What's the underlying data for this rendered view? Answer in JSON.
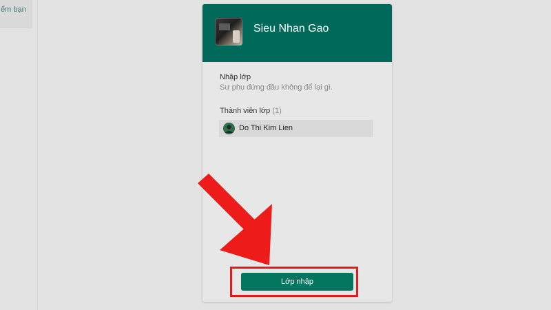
{
  "sidebar": {
    "link_text": "ểm bạn"
  },
  "card": {
    "class_name": "Sieu Nhan Gao",
    "join_section_title": "Nhập lớp",
    "join_section_note": "Sư phụ đứng đầu không để lại gì.",
    "members_title": "Thành viên lớp",
    "members_count": "(1)",
    "members": [
      {
        "name": "Do Thi Kim Lien"
      }
    ],
    "join_button_label": "Lớp nhập"
  },
  "colors": {
    "header": "#01695a",
    "button": "#04755f",
    "annotation": "#e21c1c"
  },
  "icons": {
    "class_thumbnail": "class-thumbnail-image",
    "member_avatar": "user-avatar-icon",
    "annotation_arrow": "red-arrow-icon"
  }
}
